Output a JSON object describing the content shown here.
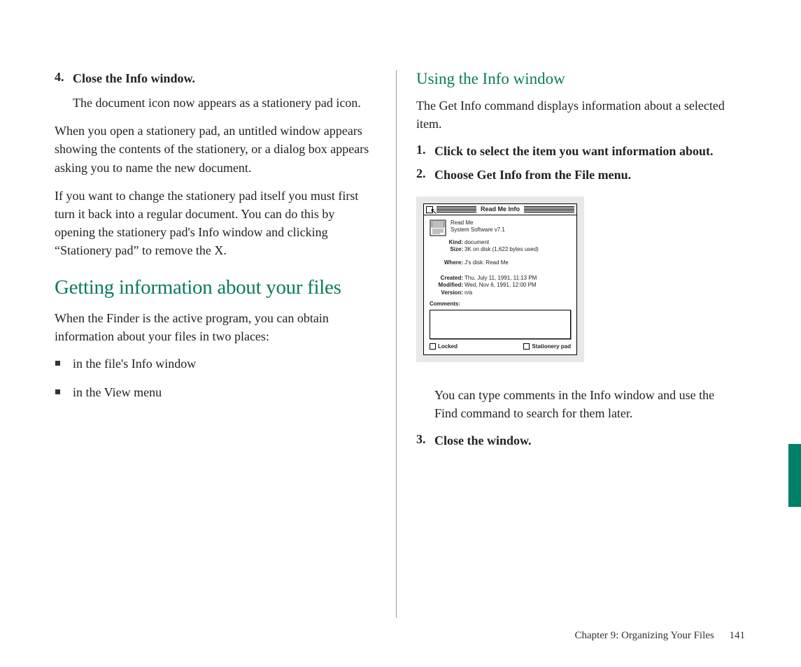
{
  "left": {
    "step": {
      "num": "4.",
      "text": "Close the Info window."
    },
    "step_sub": "The document icon now appears as a stationery pad icon.",
    "p1": "When you open a stationery pad, an untitled window appears showing the contents of the stationery, or a dialog box appears asking you to name the new document.",
    "p2": "If you want to change the stationery pad itself you must first turn it back into a regular document. You can do this by opening the stationery pad's Info window and clicking “Stationery pad” to remove the X.",
    "h1": "Getting information about your files",
    "p3": "When the Finder is the active program, you can obtain information about your files in two places:",
    "bullets": [
      "in the file's Info window",
      "in the View menu"
    ]
  },
  "right": {
    "h2": "Using the Info window",
    "intro": "The Get Info command displays information about a selected item.",
    "step1": {
      "num": "1.",
      "text": "Click to select the item you want information about."
    },
    "step2": {
      "num": "2.",
      "text": "Choose Get Info from the File menu."
    },
    "note": "You can type comments in the Info window and use the Find command to search for them later.",
    "step3": {
      "num": "3.",
      "text": "Close the window."
    }
  },
  "info_window": {
    "title": "Read Me Info",
    "name": "Read Me",
    "app": "System Software v7.1",
    "kind_label": "Kind:",
    "kind": "document",
    "size_label": "Size:",
    "size": "3K on disk (1,622 bytes used)",
    "where_label": "Where:",
    "where": "J's disk: Read Me",
    "created_label": "Created:",
    "created": "Thu, July 11, 1991, 11:13 PM",
    "modified_label": "Modified:",
    "modified": "Wed, Nov 6, 1991, 12:00 PM",
    "version_label": "Version:",
    "version": "n/a",
    "comments_label": "Comments:",
    "locked": "Locked",
    "stationery": "Stationery pad"
  },
  "footer": {
    "chapter": "Chapter 9: Organizing Your Files",
    "page": "141"
  }
}
